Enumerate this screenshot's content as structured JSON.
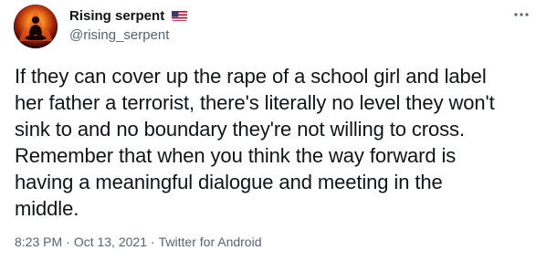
{
  "user": {
    "display_name": "Rising serpent",
    "handle": "@rising_serpent",
    "avatar_icon": "meditating-figure-fire-avatar",
    "badge_icon": "us-flag-icon"
  },
  "tweet": {
    "text": "If they can cover up the rape of a school girl and label\nher father a terrorist, there's literally no level they won't\nsink to and no boundary they're not willing to cross.\nRemember that when you think the way forward is\nhaving a meaningful dialogue and meeting in the\nmiddle."
  },
  "meta": {
    "time": "8:23 PM",
    "separator": "·",
    "date": "Oct 13, 2021",
    "source": "Twitter for Android"
  },
  "icons": {
    "more": "more-options-icon"
  },
  "colors": {
    "text_primary": "#0f1419",
    "text_secondary": "#536471",
    "background": "#ffffff"
  }
}
